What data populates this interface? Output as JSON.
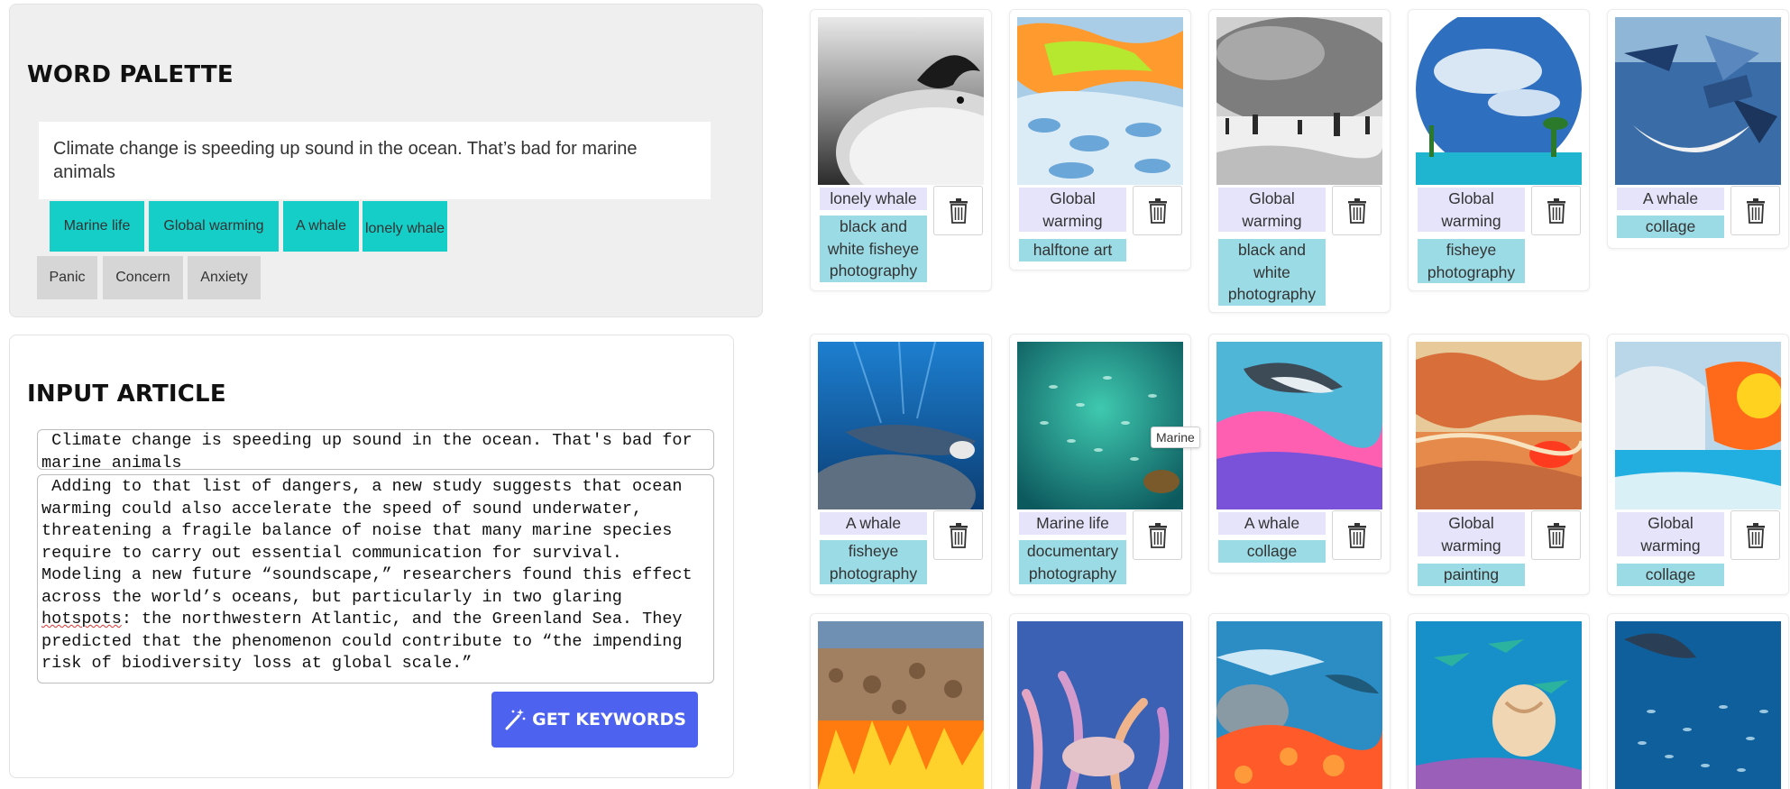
{
  "word_palette": {
    "title": "WORD PALETTE",
    "sentence": "Climate change is speeding up sound in the ocean. That’s bad for marine animals",
    "keyword_chips": [
      "Marine life",
      "Global warming",
      "A whale",
      "lonely whale"
    ],
    "emotion_chips": [
      "Panic",
      "Concern",
      "Anxiety"
    ],
    "colors": {
      "keyword_chip": "#16cec8",
      "emotion_chip": "#d6d6d6"
    }
  },
  "input_article": {
    "title": "INPUT ARTICLE",
    "headline": " Climate change is speeding up sound in the ocean. That's bad for marine animals",
    "body_before": " Adding to that list of dangers, a new study suggests that ocean warming could also accelerate the speed of sound underwater, threatening a fragile balance of noise that many marine species require to carry out essential communication for survival. Modeling a new future “soundscape,” researchers found this effect across the world’s oceans, but particularly in two glaring ",
    "body_flagged_word": "hotspots",
    "body_after": ": the northwestern Atlantic, and the Greenland Sea. They predicted that the phenomenon could contribute to “the impending risk of biodiversity loss at global scale.”",
    "button_label": "GET KEYWORDS",
    "button_icon": "magic-wand-icon",
    "button_color": "#4d63f0"
  },
  "gallery": {
    "tooltip": "Marine",
    "trash_icon": "trash-icon",
    "colors": {
      "keyword_tag": "#e6e4fb",
      "style_tag": "#9bdbe5"
    },
    "cards": [
      {
        "keyword": "lonely whale",
        "style": "black and white fisheye photography"
      },
      {
        "keyword": "Global warming",
        "style": "halftone art"
      },
      {
        "keyword": "Global warming",
        "style": "black and white photography"
      },
      {
        "keyword": "Global warming",
        "style": "fisheye photography"
      },
      {
        "keyword": "A whale",
        "style": "collage"
      },
      {
        "keyword": "A whale",
        "style": "fisheye photography"
      },
      {
        "keyword": "Marine life",
        "style": "documentary photography"
      },
      {
        "keyword": "A whale",
        "style": "collage"
      },
      {
        "keyword": "Global warming",
        "style": "painting"
      },
      {
        "keyword": "Global warming",
        "style": "collage"
      }
    ]
  }
}
